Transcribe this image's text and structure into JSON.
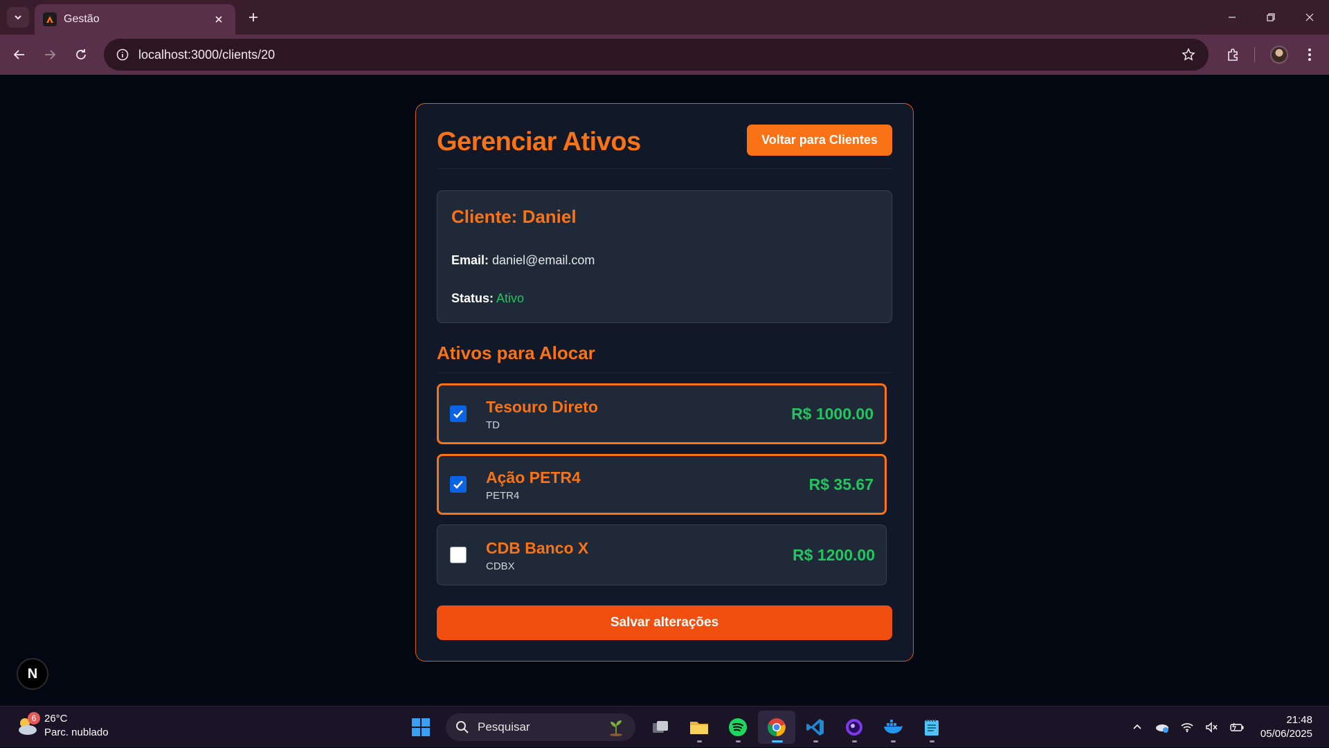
{
  "browser": {
    "tab_title": "Gestão",
    "url": "localhost:3000/clients/20"
  },
  "header": {
    "title": "Gerenciar Ativos",
    "back_label": "Voltar para Clientes"
  },
  "client": {
    "heading": "Cliente: Daniel",
    "email_label": "Email:",
    "email": "daniel@email.com",
    "status_label": "Status:",
    "status": "Ativo"
  },
  "assets_section": {
    "title": "Ativos para Alocar",
    "items": [
      {
        "name": "Tesouro Direto",
        "code": "TD",
        "value": "R$ 1000.00",
        "checked": true
      },
      {
        "name": "Ação PETR4",
        "code": "PETR4",
        "value": "R$ 35.67",
        "checked": true
      },
      {
        "name": "CDB Banco X",
        "code": "CDBX",
        "value": "R$ 1200.00",
        "checked": false
      }
    ]
  },
  "save_label": "Salvar alterações",
  "dev_badge": "N",
  "taskbar": {
    "weather_temp": "26°C",
    "weather_desc": "Parc. nublado",
    "weather_badge": "6",
    "search_placeholder": "Pesquisar",
    "time": "21:48",
    "date": "05/06/2025"
  },
  "colors": {
    "accent": "#f97316",
    "save": "#f04f0f",
    "success": "#22c55e",
    "card_bg": "#111827",
    "page_bg": "#030712"
  }
}
